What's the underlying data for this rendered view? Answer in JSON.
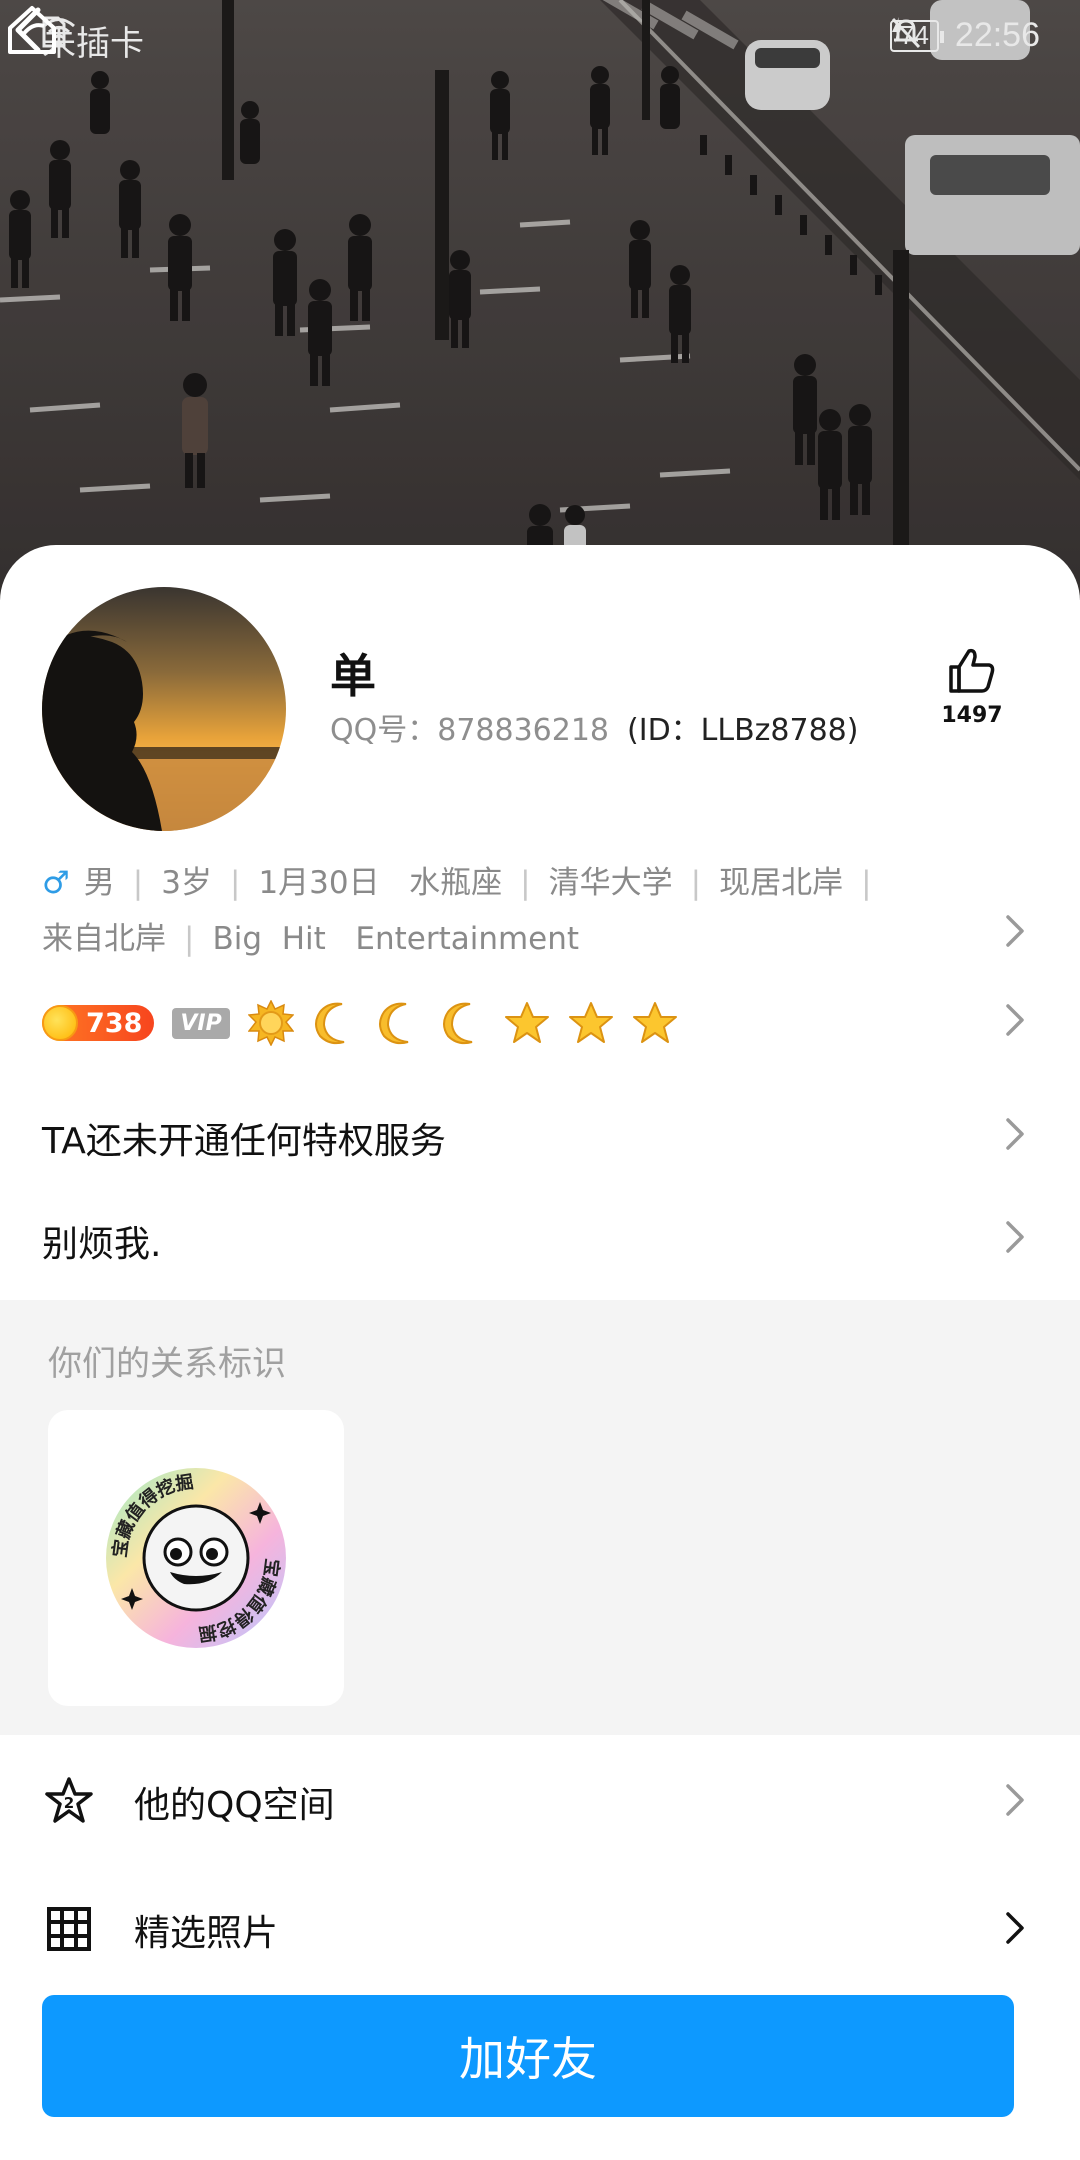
{
  "status_bar": {
    "carrier": "未插卡",
    "battery": "74",
    "time": "22:56"
  },
  "profile": {
    "nickname": "单",
    "qq_number": "QQ号：878836218",
    "qid": "(ID：LLBz8788)",
    "likes": "1497"
  },
  "info": {
    "gender_symbol": "♂",
    "gender": "男",
    "age": "3岁",
    "birthday": "1月30日",
    "zodiac": "水瓶座",
    "school": "清华大学",
    "location": "现居北岸",
    "hometown": "来自北岸",
    "company": "Big  Hit   Entertainment"
  },
  "badges": {
    "coin_value": "738",
    "vip_label": "VIP",
    "level_icons": [
      "sun-icon",
      "moon-icon",
      "moon-icon",
      "moon-icon",
      "star-icon",
      "star-icon",
      "star-icon"
    ]
  },
  "privilege_text": "TA还未开通任何特权服务",
  "signature": "别烦我.",
  "relation": {
    "title": "你们的关系标识",
    "badge_text": "宝藏值得挖掘"
  },
  "menu": [
    {
      "label": "他的QQ空间",
      "icon": "star-two-icon"
    },
    {
      "label": "精选照片",
      "icon": "grid-icon"
    }
  ],
  "add_button": "加好友",
  "colors": {
    "accent": "#0d99ff",
    "male": "#2e9ce6",
    "coin": "#f7451e"
  }
}
